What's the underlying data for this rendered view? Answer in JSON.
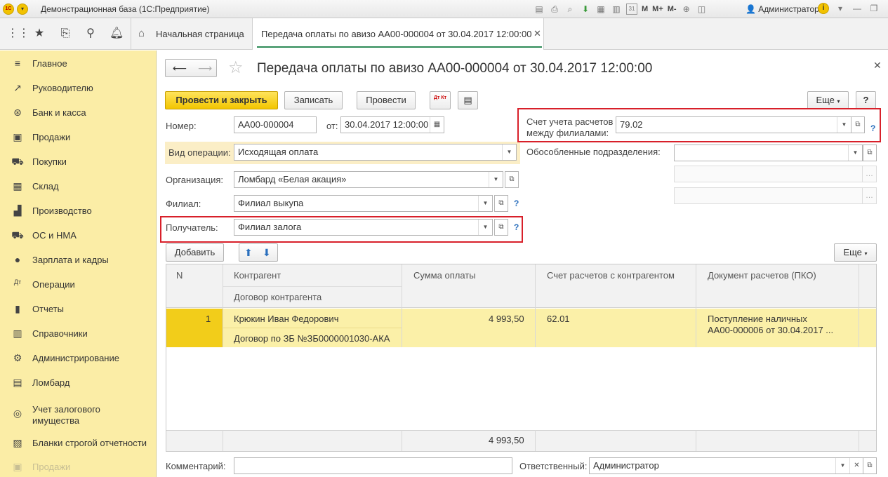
{
  "app": {
    "title": "Демонстрационная база  (1С:Предприятие)",
    "logo_text": "1С",
    "user": "Администратор",
    "toolbar_m": "M",
    "toolbar_mplus": "M+",
    "toolbar_mminus": "M-",
    "calendar_day": "31"
  },
  "tabs": {
    "home": "Начальная страница",
    "doc": "Передача оплаты по авизо АА00-000004 от 30.04.2017 12:00:00"
  },
  "sidebar": {
    "items": [
      {
        "label": "Главное",
        "icon": "list-icon"
      },
      {
        "label": "Руководителю",
        "icon": "trend-icon"
      },
      {
        "label": "Банк и касса",
        "icon": "coin-icon"
      },
      {
        "label": "Продажи",
        "icon": "bag-icon"
      },
      {
        "label": "Покупки",
        "icon": "cart-icon"
      },
      {
        "label": "Склад",
        "icon": "warehouse-icon"
      },
      {
        "label": "Производство",
        "icon": "factory-icon"
      },
      {
        "label": "ОС и НМА",
        "icon": "truck-icon"
      },
      {
        "label": "Зарплата и кадры",
        "icon": "person-icon"
      },
      {
        "label": "Операции",
        "icon": "dtkt-icon"
      },
      {
        "label": "Отчеты",
        "icon": "bar-chart-icon"
      },
      {
        "label": "Справочники",
        "icon": "book-icon"
      },
      {
        "label": "Администрирование",
        "icon": "gear-icon"
      },
      {
        "label": "Ломбард",
        "icon": "ledger-icon"
      },
      {
        "label": "Учет залогового имущества",
        "icon": "ring-icon"
      },
      {
        "label": "Бланки строгой отчетности",
        "icon": "blank-icon"
      },
      {
        "label": "Продажи",
        "icon": "bag-icon"
      }
    ]
  },
  "form": {
    "title": "Передача оплаты по авизо АА00-000004 от 30.04.2017 12:00:00",
    "buttons": {
      "post_close": "Провести и закрыть",
      "save": "Записать",
      "post": "Провести",
      "more": "Еще",
      "help": "?",
      "dtkt": "Дт Кт"
    },
    "number_label": "Номер:",
    "number_value": "АА00-000004",
    "date_label": "от:",
    "date_value": "30.04.2017 12:00:00",
    "operation_label": "Вид операции:",
    "operation_value": "Исходящая оплата",
    "org_label": "Организация:",
    "org_value": "Ломбард «Белая акация»",
    "branch_label": "Филиал:",
    "branch_value": "Филиал выкупа",
    "recipient_label": "Получатель:",
    "recipient_value": "Филиал залога",
    "account_label_1": "Счет учета расчетов",
    "account_label_2": "между филиалами:",
    "account_value": "79.02",
    "subdiv_label": "Обособленные подразделения:",
    "subdiv_value": "",
    "help_mark": "?"
  },
  "table_toolbar": {
    "add": "Добавить",
    "more": "Еще"
  },
  "table": {
    "headers": {
      "n": "N",
      "counterparty": "Контрагент",
      "contract": "Договор контрагента",
      "amount": "Сумма оплаты",
      "account": "Счет расчетов с контрагентом",
      "document": "Документ расчетов (ПКО)"
    },
    "rows": [
      {
        "n": "1",
        "counterparty": "Крюкин Иван Федорович",
        "contract": "Договор по ЗБ №ЗБ0000001030-АКА",
        "amount": "4 993,50",
        "account": "62.01",
        "document_1": "Поступление наличных",
        "document_2": "АА00-000006 от 30.04.2017 ..."
      }
    ],
    "total_amount": "4 993,50"
  },
  "footer": {
    "comment_label": "Комментарий:",
    "comment_value": "",
    "responsible_label": "Ответственный:",
    "responsible_value": "Администратор"
  },
  "colors": {
    "sidebar_bg": "#fbeda6",
    "primary_button": "#f2c500",
    "highlight_red": "#d8202a",
    "selected_row": "#fbf0a8"
  }
}
